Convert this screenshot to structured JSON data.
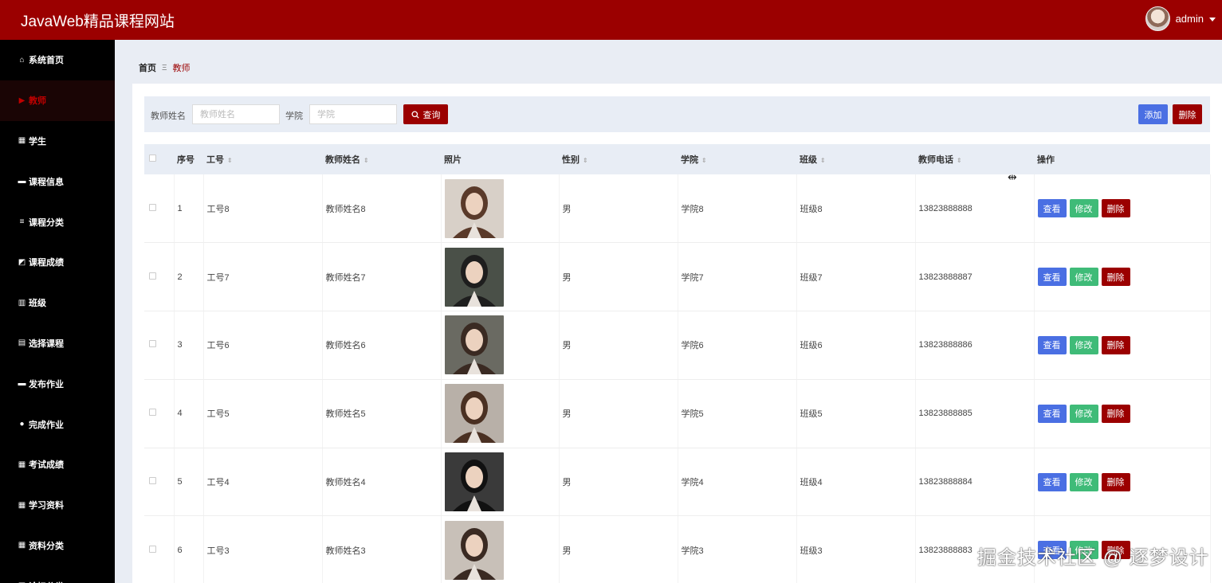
{
  "header": {
    "title": "JavaWeb精品课程网站",
    "username": "admin"
  },
  "sidebar": {
    "items": [
      {
        "label": "系统首页",
        "icon": "home-icon",
        "glyph": "⌂",
        "active": false
      },
      {
        "label": "教师",
        "icon": "flag-icon",
        "glyph": "▶",
        "active": true
      },
      {
        "label": "学生",
        "icon": "grid-icon",
        "glyph": "▦",
        "active": false
      },
      {
        "label": "课程信息",
        "icon": "briefcase-icon",
        "glyph": "▬",
        "active": false
      },
      {
        "label": "课程分类",
        "icon": "list-icon",
        "glyph": "≡",
        "active": false
      },
      {
        "label": "课程成绩",
        "icon": "chart-icon",
        "glyph": "◩",
        "active": false
      },
      {
        "label": "班级",
        "icon": "bar-chart-icon",
        "glyph": "▥",
        "active": false
      },
      {
        "label": "选择课程",
        "icon": "clipboard-icon",
        "glyph": "▤",
        "active": false
      },
      {
        "label": "发布作业",
        "icon": "comment-icon",
        "glyph": "▬",
        "active": false
      },
      {
        "label": "完成作业",
        "icon": "user-icon",
        "glyph": "●",
        "active": false
      },
      {
        "label": "考试成绩",
        "icon": "grid-icon",
        "glyph": "▦",
        "active": false
      },
      {
        "label": "学习资料",
        "icon": "grid-icon",
        "glyph": "▦",
        "active": false
      },
      {
        "label": "资料分类",
        "icon": "grid-icon",
        "glyph": "▦",
        "active": false
      },
      {
        "label": "论坛分类",
        "icon": "grid-icon",
        "glyph": "▦",
        "active": false
      }
    ]
  },
  "breadcrumb": {
    "home": "首页",
    "separator": "Ξ",
    "current": "教师"
  },
  "search": {
    "name_label": "教师姓名",
    "name_placeholder": "教师姓名",
    "college_label": "学院",
    "college_placeholder": "学院",
    "query_label": "查询",
    "add_label": "添加",
    "delete_label": "删除"
  },
  "table": {
    "headers": {
      "index": "序号",
      "id": "工号",
      "name": "教师姓名",
      "photo": "照片",
      "gender": "性别",
      "college": "学院",
      "class": "班级",
      "phone": "教师电话",
      "ops": "操作"
    },
    "actions": {
      "view": "查看",
      "edit": "修改",
      "delete": "删除"
    },
    "rows": [
      {
        "index": "1",
        "id": "工号8",
        "name": "教师姓名8",
        "gender": "男",
        "college": "学院8",
        "class": "班级8",
        "phone": "13823888888",
        "photo_bg": "#d8d0c8",
        "photo_fg": "#5a3a2a"
      },
      {
        "index": "2",
        "id": "工号7",
        "name": "教师姓名7",
        "gender": "男",
        "college": "学院7",
        "class": "班级7",
        "phone": "13823888887",
        "photo_bg": "#4a5048",
        "photo_fg": "#1e1e1e"
      },
      {
        "index": "3",
        "id": "工号6",
        "name": "教师姓名6",
        "gender": "男",
        "college": "学院6",
        "class": "班级6",
        "phone": "13823888886",
        "photo_bg": "#6a6a62",
        "photo_fg": "#3a2a22"
      },
      {
        "index": "4",
        "id": "工号5",
        "name": "教师姓名5",
        "gender": "男",
        "college": "学院5",
        "class": "班级5",
        "phone": "13823888885",
        "photo_bg": "#b8b0a8",
        "photo_fg": "#4a3022"
      },
      {
        "index": "5",
        "id": "工号4",
        "name": "教师姓名4",
        "gender": "男",
        "college": "学院4",
        "class": "班级4",
        "phone": "13823888884",
        "photo_bg": "#3a3a3a",
        "photo_fg": "#111111"
      },
      {
        "index": "6",
        "id": "工号3",
        "name": "教师姓名3",
        "gender": "男",
        "college": "学院3",
        "class": "班级3",
        "phone": "13823888883",
        "photo_bg": "#c8c0b8",
        "photo_fg": "#3a2a22"
      }
    ]
  },
  "watermark": "掘金技术社区 @ 逐梦设计",
  "colors": {
    "brand": "#9b0000",
    "view": "#4a6fe3",
    "edit": "#3fbb78",
    "delete": "#9b0000",
    "sidebar": "#000000"
  }
}
